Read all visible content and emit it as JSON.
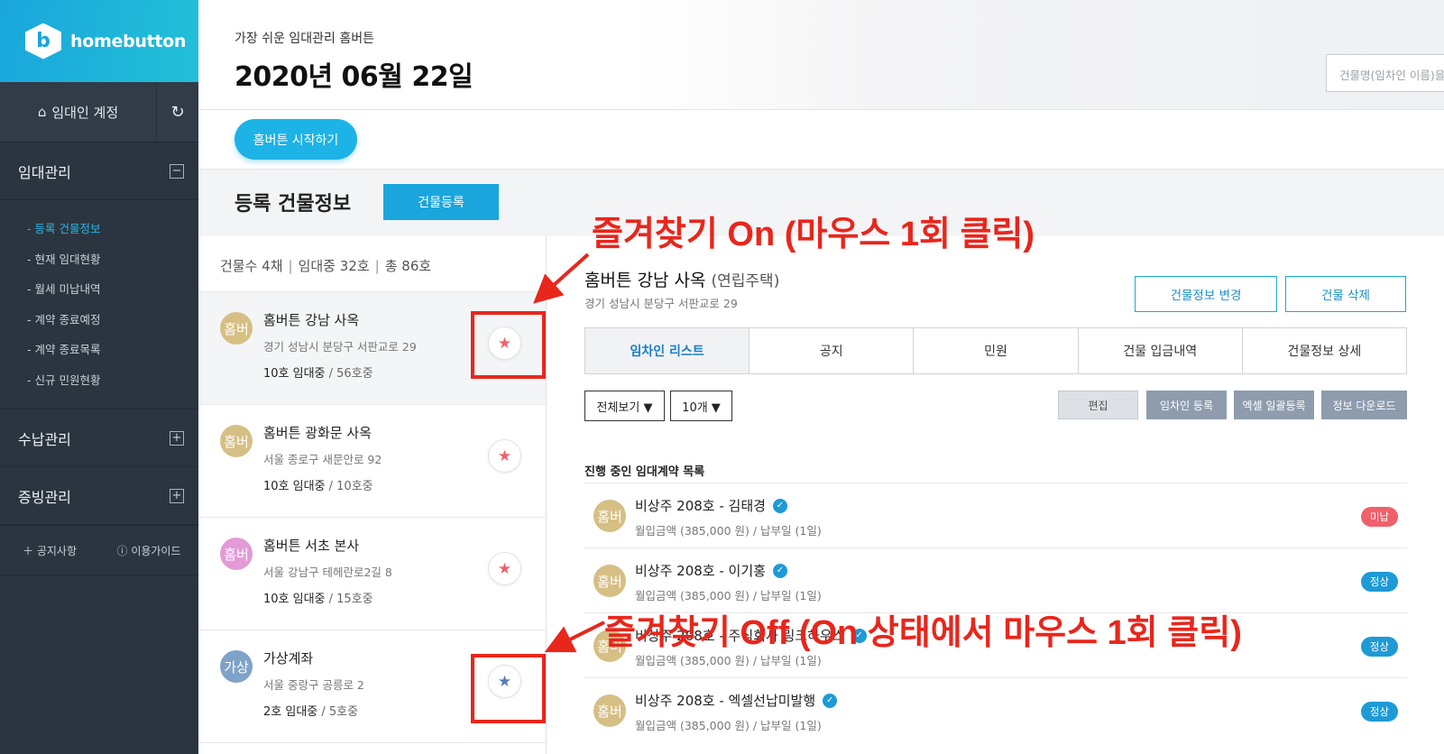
{
  "brand": {
    "name": "homebutton",
    "logo_letter": "b"
  },
  "sidebar": {
    "account_label": "임대인 계정",
    "sections": [
      {
        "label": "임대관리",
        "toggle": "−",
        "items": [
          {
            "label": "- 등록 건물정보",
            "active": true
          },
          {
            "label": "- 현재 임대현황",
            "active": false
          },
          {
            "label": "- 월세 미납내역",
            "active": false
          },
          {
            "label": "- 계약 종료예정",
            "active": false
          },
          {
            "label": "- 계약 종료목록",
            "active": false
          },
          {
            "label": "- 신규 민원현황",
            "active": false
          }
        ]
      },
      {
        "label": "수납관리",
        "toggle": "+"
      },
      {
        "label": "증빙관리",
        "toggle": "+"
      }
    ],
    "footer": {
      "notice": "공지사항",
      "guide": "이용가이드"
    }
  },
  "header": {
    "subtitle": "가장 쉬운 임대관리 홈버튼",
    "date": "2020년 06월 22일",
    "search_placeholder": "건물명(임차인 이름)을"
  },
  "start_button": "홈버튼 시작하기",
  "section": {
    "title": "등록 건물정보",
    "register_button": "건물등록"
  },
  "summary": {
    "buildings": "건물수 4채",
    "occupied": "임대중 32호",
    "total": "총 86호"
  },
  "buildings": [
    {
      "avatar": "홈버",
      "avatar_color": "#d6bf84",
      "name": "홈버튼 강남 사옥",
      "address": "경기 성남시 분당구 서판교로 29",
      "occupied": "10호 임대중",
      "total": " / 56호중",
      "favorite": true
    },
    {
      "avatar": "홈버",
      "avatar_color": "#d6bf84",
      "name": "홈버튼 광화문 사옥",
      "address": "서울 종로구 새문안로 92",
      "occupied": "10호 임대중",
      "total": " / 10호중",
      "favorite": true
    },
    {
      "avatar": "홈버",
      "avatar_color": "#e39ad6",
      "name": "홈버튼 서초 본사",
      "address": "서울 강남구 테헤란로2길 8",
      "occupied": "10호 임대중",
      "total": " / 15호중",
      "favorite": true
    },
    {
      "avatar": "가상",
      "avatar_color": "#7ea2c8",
      "name": "가상계좌",
      "address": "서울 중랑구 공릉로 2",
      "occupied": "2호 임대중",
      "total": " / 5호중",
      "favorite": false
    }
  ],
  "detail": {
    "name": "홈버튼 강남 사옥",
    "type": "(연립주택)",
    "address": "경기 성남시 분당구 서판교로 29",
    "edit_button": "건물정보 변경",
    "delete_button": "건물 삭제",
    "tabs": [
      "임차인 리스트",
      "공지",
      "민원",
      "건물 입금내역",
      "건물정보 상세"
    ],
    "filter_view": "전체보기 ▼",
    "filter_count": "10개 ▼",
    "actions": [
      "편집",
      "임차인 등록",
      "엑셀 일괄등록",
      "정보 다운로드"
    ],
    "contracts_title": "진행 중인 임대계약 목록",
    "contracts": [
      {
        "avatar": "홈버",
        "title": "비상주 208호 - 김태경",
        "sub": "월입금액 (385,000 원) / 납부일 (1일)",
        "status": "미납",
        "status_type": "unpaid"
      },
      {
        "avatar": "홈버",
        "title": "비상주 208호 - 이기홍",
        "sub": "월입금액 (385,000 원) / 납부일 (1일)",
        "status": "정상",
        "status_type": "ok"
      },
      {
        "avatar": "홈버",
        "title": "비상주 208호 - 주식회사 링크하우스",
        "sub": "월입금액 (385,000 원) / 납부일 (1일)",
        "status": "정상",
        "status_type": "ok"
      },
      {
        "avatar": "홈버",
        "title": "비상주 208호 - 엑셀선납미발행",
        "sub": "월입금액 (385,000 원) / 납부일 (1일)",
        "status": "정상",
        "status_type": "ok"
      }
    ]
  },
  "annotations": {
    "on": "즐겨찾기 On (마우스 1회 클릭)",
    "off": "즐겨찾기 Off (On 상태에서 마우스 1회 클릭)"
  }
}
